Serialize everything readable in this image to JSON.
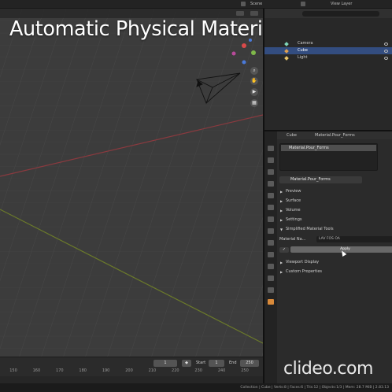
{
  "overlay": {
    "title": "Automatic Physical Material name",
    "watermark": "clideo.com"
  },
  "topbar": {
    "scene_label": "Scene",
    "view_layer_label": "View Layer"
  },
  "outliner": {
    "rows": [
      {
        "label": "Camera",
        "selected": false
      },
      {
        "label": "Cube",
        "selected": true
      },
      {
        "label": "Light",
        "selected": false
      }
    ]
  },
  "properties": {
    "header_object": "Cube",
    "header_material": "Material.Pour_Forms",
    "slot_item": "Material.Pour_Forms",
    "material_field": "Material.Pour_Forms",
    "panels": [
      "Preview",
      "Surface",
      "Volume",
      "Settings",
      "Simplified Material Tools"
    ],
    "material_name_label": "Material Na...",
    "material_name_value": "LAV FOS OA",
    "apply_label": "Apply",
    "extra_panels": [
      "Viewport Display",
      "Custom Properties"
    ]
  },
  "timeline": {
    "current_frame": "1",
    "start_label": "Start",
    "start_value": "1",
    "end_label": "End",
    "end_value": "250",
    "ticks": [
      "150",
      "160",
      "170",
      "180",
      "190",
      "200",
      "210",
      "220",
      "230",
      "240",
      "250"
    ]
  },
  "statusbar": {
    "text": "Collection | Cube | Verts:8 | Faces:6 | Tris:12 | Objects:1/3 | Mem: 28.7 MiB | 2.83.13"
  },
  "colors": {
    "x_axis": "#8a3a3f",
    "y_axis": "#6b7a2a",
    "selection": "#334d80",
    "accent": "#d98a3a"
  }
}
